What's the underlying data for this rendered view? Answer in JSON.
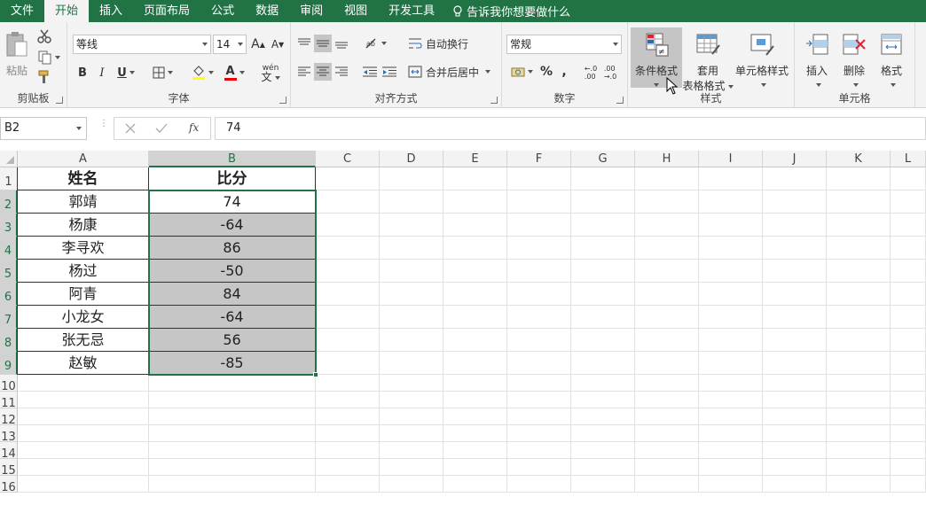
{
  "tabs": [
    "文件",
    "开始",
    "插入",
    "页面布局",
    "公式",
    "数据",
    "审阅",
    "视图",
    "开发工具"
  ],
  "tell_me": "告诉我你想要做什么",
  "clipboard": {
    "paste": "粘贴",
    "label": "剪贴板"
  },
  "font": {
    "name": "等线",
    "size": "14",
    "label": "字体",
    "bold": "B",
    "italic": "I",
    "underline": "U",
    "grow": "A",
    "shrink": "A",
    "font_color": "A",
    "pinyin": "wén"
  },
  "alignment": {
    "wrap": "自动换行",
    "merge": "合并后居中",
    "label": "对齐方式"
  },
  "number": {
    "format": "常规",
    "label": "数字",
    "percent": "%",
    "comma": ",",
    "inc_dec": "←.0 .00",
    "dec_dec": ".00 →.0"
  },
  "styles": {
    "conditional": "条件格式",
    "table_line1": "套用",
    "table_line2": "表格格式",
    "cell_styles": "单元格样式",
    "label": "样式"
  },
  "cells": {
    "insert": "插入",
    "delete": "删除",
    "format": "格式",
    "label": "单元格"
  },
  "formula_bar": {
    "name_box": "B2",
    "fx": "fx",
    "value": "74"
  },
  "columns": [
    "A",
    "B",
    "C",
    "D",
    "E",
    "F",
    "G",
    "H",
    "I",
    "J",
    "K",
    "L"
  ],
  "rows": [
    "1",
    "2",
    "3",
    "4",
    "5",
    "6",
    "7",
    "8",
    "9",
    "10",
    "11",
    "12",
    "13",
    "14",
    "15",
    "16"
  ],
  "table": {
    "headers": [
      "姓名",
      "比分"
    ],
    "rows": [
      [
        "郭靖",
        "74"
      ],
      [
        "杨康",
        "-64"
      ],
      [
        "李寻欢",
        "86"
      ],
      [
        "杨过",
        "-50"
      ],
      [
        "阿青",
        "84"
      ],
      [
        "小龙女",
        "-64"
      ],
      [
        "张无忌",
        "56"
      ],
      [
        "赵敏",
        "-85"
      ]
    ]
  },
  "colors": {
    "accent": "#217346",
    "shade": "#c6c6c6"
  }
}
